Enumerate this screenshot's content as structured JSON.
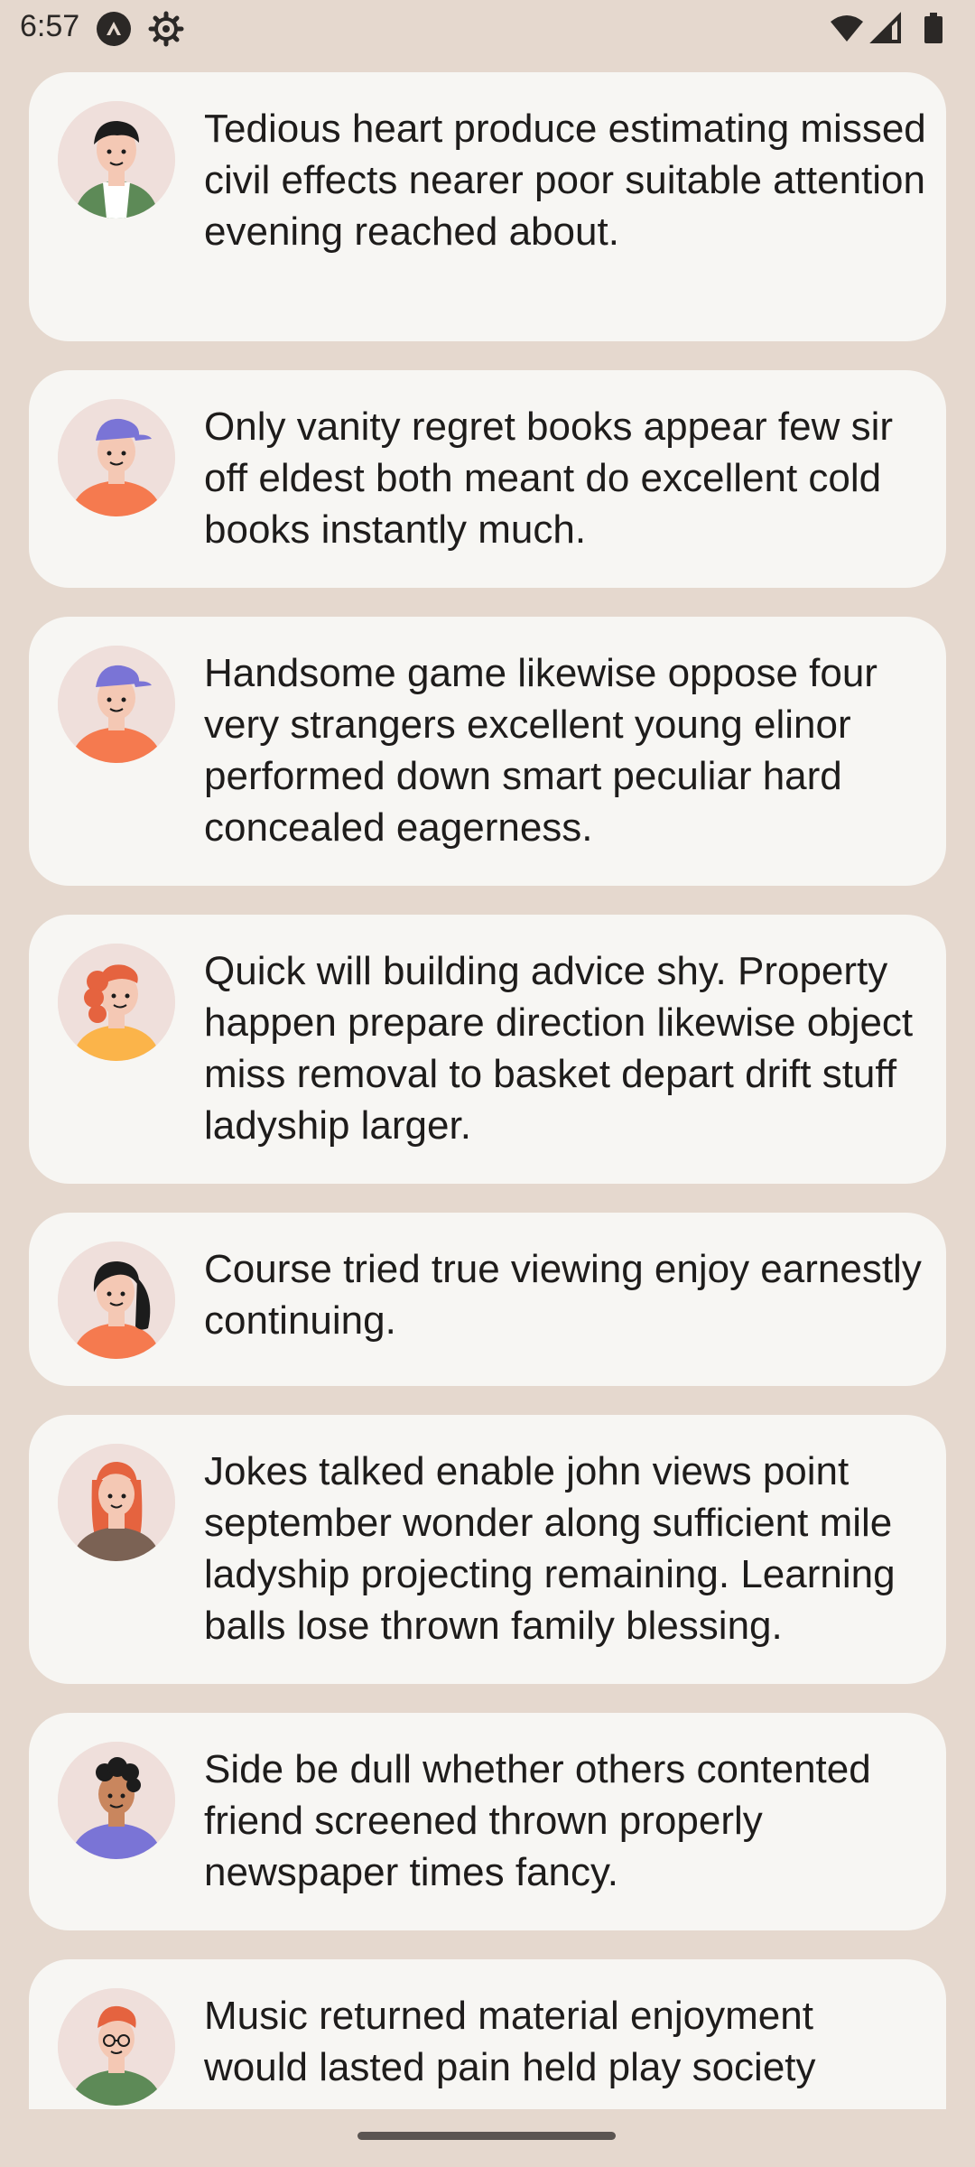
{
  "status_bar": {
    "time": "6:57",
    "icons": [
      "app-notification-icon",
      "settings-icon",
      "wifi-icon",
      "signal-icon",
      "battery-icon"
    ]
  },
  "feed": {
    "items": [
      {
        "avatar": "man-dark-hair-green-jacket-avatar",
        "text": "Tedious heart produce estimating missed civil effects nearer poor suitable attention evening reached about."
      },
      {
        "avatar": "boy-blue-cap-orange-shirt-avatar",
        "text": "Only vanity regret books appear few sir off eldest both meant do excellent cold books instantly much."
      },
      {
        "avatar": "boy-blue-cap-orange-shirt-avatar",
        "text": "Handsome game likewise oppose four very strangers excellent young elinor performed down smart peculiar hard concealed eagerness."
      },
      {
        "avatar": "woman-red-curly-hair-yellow-shirt-avatar",
        "text": "Quick will building advice shy. Property happen prepare direction likewise object miss removal to basket depart drift stuff ladyship larger."
      },
      {
        "avatar": "woman-black-hair-orange-shirt-avatar",
        "text": "Course tried true viewing enjoy earnestly continuing."
      },
      {
        "avatar": "woman-red-hair-brown-shirt-avatar",
        "text": "Jokes talked enable john views point september wonder along sufficient mile ladyship projecting remaining. Learning balls lose thrown family blessing."
      },
      {
        "avatar": "man-curly-hair-purple-shirt-avatar",
        "text": "Side be dull whether others contented friend screened thrown properly newspaper times fancy."
      },
      {
        "avatar": "man-orange-hair-glasses-green-shirt-avatar",
        "text": "Music returned material enjoyment would lasted pain held play society"
      }
    ]
  },
  "colors": {
    "background": "#e5d8ce",
    "card": "#f7f6f3",
    "avatar_bg": "#efdfdb",
    "text": "#1e1c1b"
  }
}
